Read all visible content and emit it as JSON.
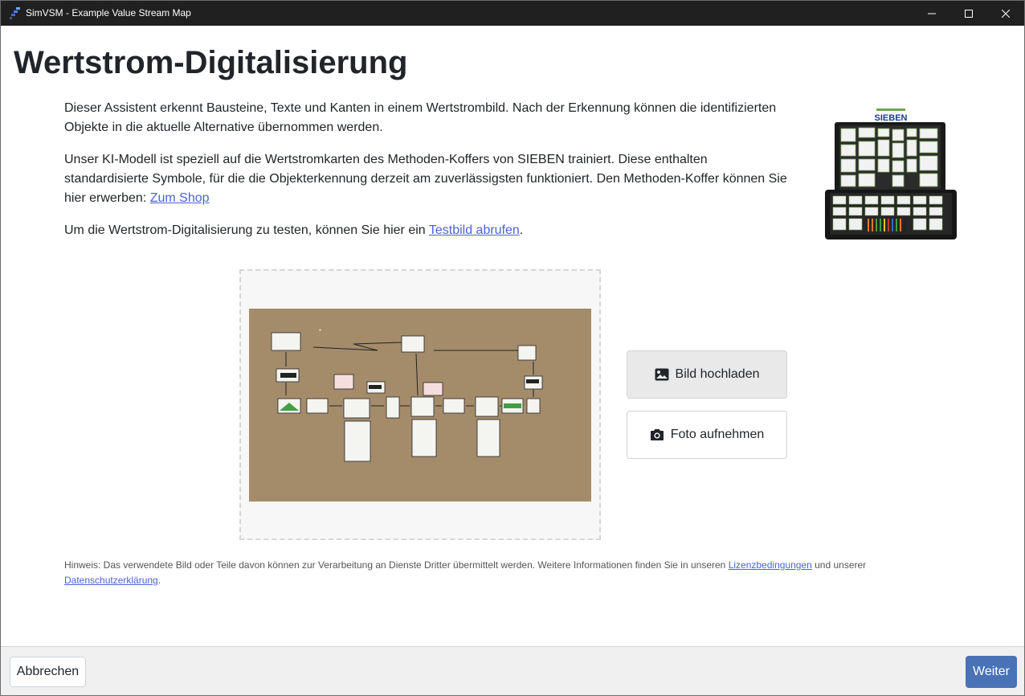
{
  "window": {
    "title": "SimVSM - Example Value Stream Map",
    "controls": [
      "minimize-icon",
      "maximize-icon",
      "close-icon"
    ]
  },
  "page": {
    "heading": "Wertstrom-Digitalisierung",
    "intro": "Dieser Assistent erkennt Bausteine, Texte und Kanten in einem Wertstrombild. Nach der Erkennung können die identifizierten Objekte in die aktuelle Alternative übernommen werden.",
    "model_text": "Unser KI-Modell ist speziell auf die Wertstromkarten des Methoden-Koffers von SIEBEN trainiert. Diese enthalten standardisierte Symbole, für die die Objekterkennung derzeit am zuverlässigsten funktioniert. Den Methoden-Koffer können Sie hier erwerben: ",
    "shop_link": "Zum Shop",
    "test_text_before": "Um die Wertstrom-Digitalisierung zu testen, können Sie hier ein ",
    "test_link": "Testbild abrufen",
    "test_text_after": ".",
    "case_brand": "SIEBEN"
  },
  "actions": {
    "upload_label": "Bild hochladen",
    "upload_icon": "image-icon",
    "camera_label": "Foto aufnehmen",
    "camera_icon": "camera-icon"
  },
  "hint": {
    "text_before": "Hinweis: Das verwendete Bild oder Teile davon können zur Verarbeitung an Dienste Dritter übermittelt werden. Weitere Informationen finden Sie in unseren ",
    "license_link": "Lizenzbedingungen",
    "text_middle": " und unserer ",
    "privacy_link": "Datenschutzerklärung",
    "text_after": "."
  },
  "footer": {
    "cancel_label": "Abbrechen",
    "next_label": "Weiter"
  },
  "colors": {
    "titlebar": "#202020",
    "link": "#4a63d6",
    "primary_button": "#4a73b6",
    "paper": "#a48c6b"
  }
}
